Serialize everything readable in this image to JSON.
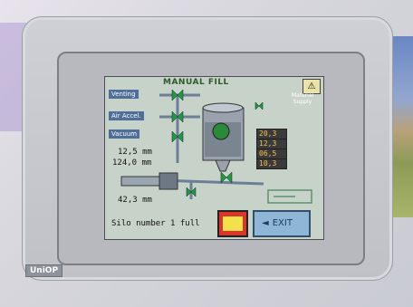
{
  "header": {
    "title": "MANUAL FILL"
  },
  "labels": {
    "venting": "Venting",
    "air_accel": "Air Accel.",
    "vacuum": "Vacuum",
    "material_supply": "Material Supply"
  },
  "readings": {
    "left": [
      "12,5 mm",
      "124,0 mm",
      "42,3 mm"
    ],
    "hopper": [
      "20,3",
      "12,3",
      "06,5",
      "10,3"
    ]
  },
  "status": {
    "message": "Silo number 1 full"
  },
  "buttons": {
    "exit_label": "EXIT",
    "action_icon": "hopper-icon"
  },
  "icons": [
    "warning-icon",
    "valve-icon",
    "tank-icon",
    "speaker-icon"
  ],
  "brand": {
    "logo": "UniOP"
  },
  "colors": {
    "screen_bg": "#c7d3c9",
    "accent": "#d9352a",
    "title": "#2d5a2d"
  }
}
